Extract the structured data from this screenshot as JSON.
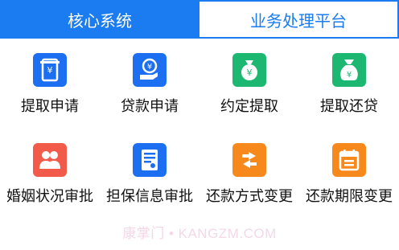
{
  "tabs": {
    "active": "核心系统",
    "inactive": "业务处理平台"
  },
  "colors": {
    "brand": "#1a7cf0",
    "blue": "#1c6ff0",
    "green": "#1cb872",
    "red": "#f25a4a",
    "orange": "#f7891c"
  },
  "grid": {
    "items": [
      {
        "label": "提取申请",
        "icon": "atm-withdraw-icon",
        "color": "#1c6ff0"
      },
      {
        "label": "贷款申请",
        "icon": "loan-hand-icon",
        "color": "#1c6ff0"
      },
      {
        "label": "约定提取",
        "icon": "money-bag-icon",
        "color": "#1cb872"
      },
      {
        "label": "提取还贷",
        "icon": "money-sack-icon",
        "color": "#1cb872"
      },
      {
        "label": "婚姻状况审批",
        "icon": "couple-icon",
        "color": "#f25a4a"
      },
      {
        "label": "担保信息审批",
        "icon": "document-icon",
        "color": "#1c6ff0"
      },
      {
        "label": "还款方式变更",
        "icon": "swap-arrows-icon",
        "color": "#f7891c"
      },
      {
        "label": "还款期限变更",
        "icon": "calendar-icon",
        "color": "#f7891c"
      }
    ]
  },
  "watermark": "康掌门 • KANGZM.COM"
}
